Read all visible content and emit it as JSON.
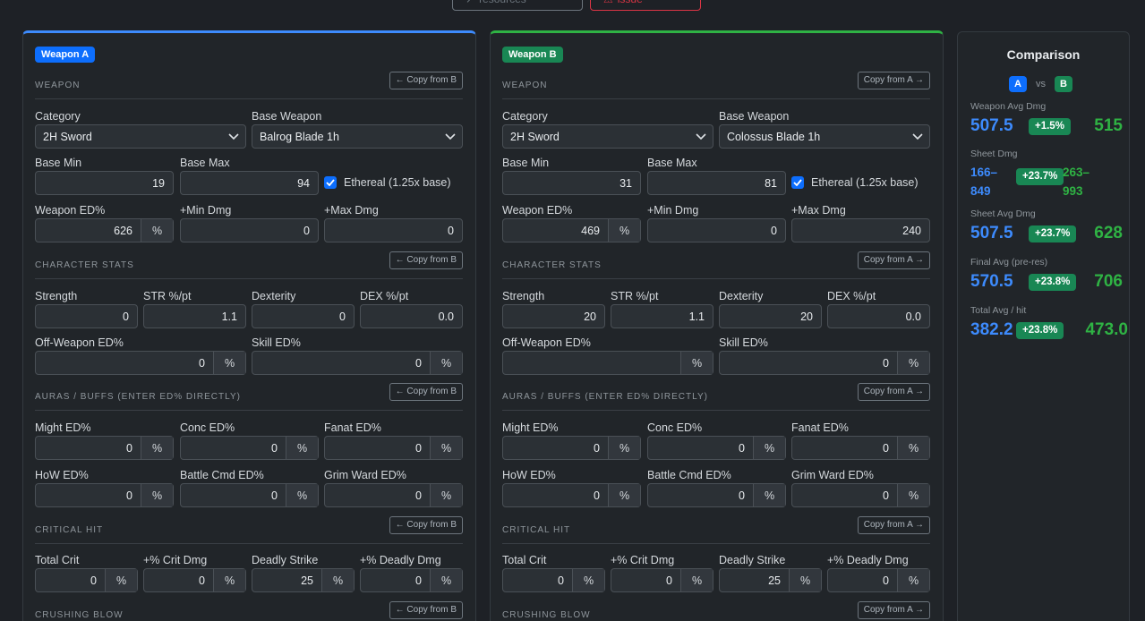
{
  "top": {
    "view_label": "View other resources",
    "report_label": "Report an issue"
  },
  "a": {
    "badge": "Weapon A",
    "copy": "← Copy from B",
    "category": "2H Sword",
    "base_weapon": "Balrog Blade 1h",
    "base_min": "19",
    "base_max": "94",
    "ethereal": "Ethereal (1.25x base)",
    "weapon_ed": "626",
    "min_dmg": "0",
    "max_dmg": "0",
    "strength": "0",
    "str_pt": "1.1",
    "dexterity": "0",
    "dex_pt": "0.0",
    "off_ed": "0",
    "skill_ed": "0",
    "might": "0",
    "conc": "0",
    "fanat": "0",
    "how": "0",
    "battle": "0",
    "grim": "0",
    "total_crit": "0",
    "crit_dmg": "0",
    "deadly": "25",
    "deadly_dmg": "0"
  },
  "b": {
    "badge": "Weapon B",
    "copy": "Copy from A →",
    "category": "2H Sword",
    "base_weapon": "Colossus Blade 1h",
    "base_min": "31",
    "base_max": "81",
    "ethereal": "Ethereal (1.25x base)",
    "weapon_ed": "469",
    "min_dmg": "0",
    "max_dmg": "240",
    "strength": "20",
    "str_pt": "1.1",
    "dexterity": "20",
    "dex_pt": "0.0",
    "off_ed": "",
    "skill_ed": "0",
    "might": "0",
    "conc": "0",
    "fanat": "0",
    "how": "0",
    "battle": "0",
    "grim": "0",
    "total_crit": "0",
    "crit_dmg": "0",
    "deadly": "25",
    "deadly_dmg": "0"
  },
  "labels": {
    "sec_weapon": "WEAPON",
    "sec_char": "CHARACTER STATS",
    "sec_aura": "AURAS / BUFFS (ENTER ED% DIRECTLY)",
    "sec_crit": "CRITICAL HIT",
    "sec_crush": "CRUSHING BLOW",
    "category": "Category",
    "base_weapon": "Base Weapon",
    "base_min": "Base Min",
    "base_max": "Base Max",
    "weapon_ed": "Weapon ED%",
    "min_dmg": "+Min Dmg",
    "max_dmg": "+Max Dmg",
    "strength": "Strength",
    "str_pt": "STR %/pt",
    "dexterity": "Dexterity",
    "dex_pt": "DEX %/pt",
    "off_ed": "Off-Weapon ED%",
    "skill_ed": "Skill ED%",
    "might": "Might ED%",
    "conc": "Conc ED%",
    "fanat": "Fanat ED%",
    "how": "HoW ED%",
    "battle": "Battle Cmd ED%",
    "grim": "Grim Ward ED%",
    "total_crit": "Total Crit",
    "crit_dmg": "+% Crit Dmg",
    "deadly": "Deadly Strike",
    "deadly_dmg": "+% Deadly Dmg",
    "pct": "%"
  },
  "comparison": {
    "title": "Comparison",
    "a": "A",
    "vs": "vs",
    "b": "B",
    "stats": [
      {
        "label": "Weapon Avg Dmg",
        "a": "507.5",
        "delta": "+1.5%",
        "b": "515"
      },
      {
        "label": "Sheet Dmg",
        "a1": "166–",
        "a2": "849",
        "delta": "+23.7%",
        "b1": "263–",
        "b2": "993"
      },
      {
        "label": "Sheet Avg Dmg",
        "a": "507.5",
        "delta": "+23.7%",
        "b": "628"
      },
      {
        "label": "Final Avg (pre-res)",
        "a": "570.5",
        "delta": "+23.8%",
        "b": "706"
      },
      {
        "label": "Total Avg / hit",
        "a": "382.2",
        "delta": "+23.8%",
        "b": "473.0"
      }
    ]
  },
  "colors": {
    "accent_a": "#0d6efd",
    "accent_b": "#198754",
    "value_a": "#3d8bfd",
    "value_b": "#2fb344"
  }
}
